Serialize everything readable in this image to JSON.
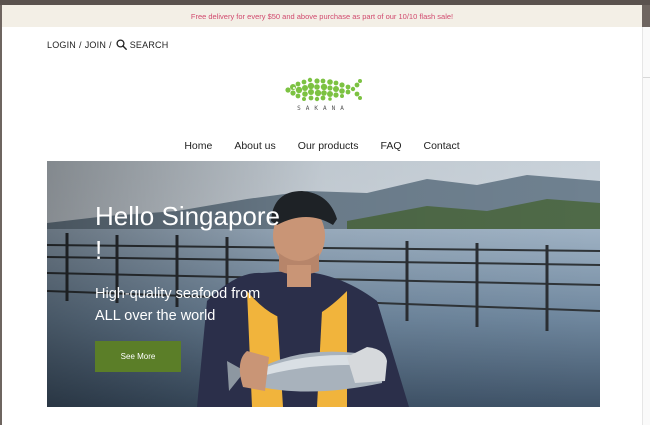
{
  "announcement": "Free delivery for every $50 and above purchase as part of our 10/10 flash sale!",
  "account": {
    "login": "LOGIN",
    "sep1": "/",
    "join": "JOIN",
    "sep2": "/",
    "search": "SEARCH"
  },
  "logo": {
    "text": "SAKANA",
    "icon": "fish-logo-icon"
  },
  "nav": {
    "items": [
      "Home",
      "About us",
      "Our products",
      "FAQ",
      "Contact"
    ]
  },
  "hero": {
    "title_line1": "Hello Singapore",
    "title_line2": "!",
    "subtitle_line1": "High-quality seafood from",
    "subtitle_line2": "ALL over the world",
    "button_label": "See More"
  },
  "colors": {
    "accent_green": "#5b7e28",
    "announcement_text": "#d14a6e",
    "announcement_bg": "#f3efe6",
    "logo_green": "#7cc242"
  }
}
